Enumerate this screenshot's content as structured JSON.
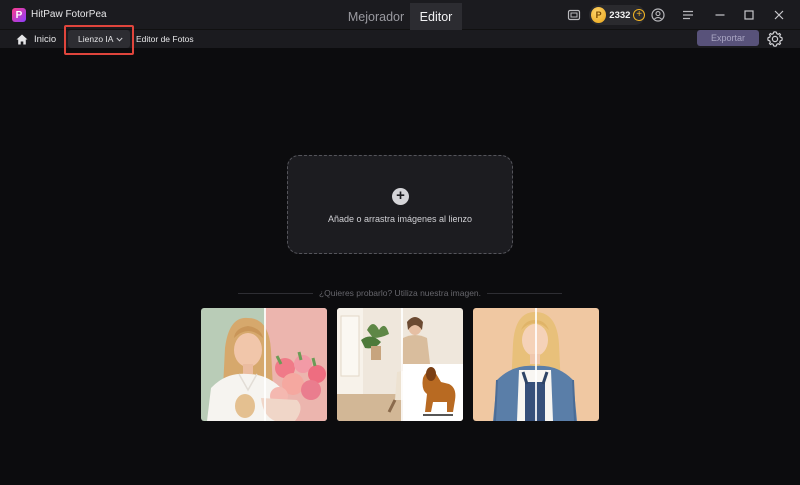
{
  "app": {
    "name": "HitPaw FotorPea",
    "logo_letter": "P",
    "tabs": [
      {
        "label": "Mejorador",
        "active": false
      },
      {
        "label": "Editor",
        "active": true
      }
    ],
    "coins": "2332",
    "icons": [
      "feedback-icon",
      "coin-icon",
      "add-coin-icon",
      "user-icon",
      "menu-icon",
      "minimize-icon",
      "maximize-icon",
      "close-icon"
    ]
  },
  "toolbar": {
    "home_label": "Inicio",
    "canvas_dropdown": "Lienzo IA",
    "photo_editor": "Editor de Fotos",
    "export_label": "Exportar"
  },
  "dropzone": {
    "text": "Añade o arrastra imágenes al lienzo"
  },
  "samples": {
    "prompt": "¿Quieres probarlo? Utiliza nuestra imagen."
  },
  "colors": {
    "background": "#0c0c0e",
    "bar": "#1b1b1f",
    "export_button": "#58527a",
    "highlight": "#e0453c",
    "coin": "#f2b424"
  }
}
